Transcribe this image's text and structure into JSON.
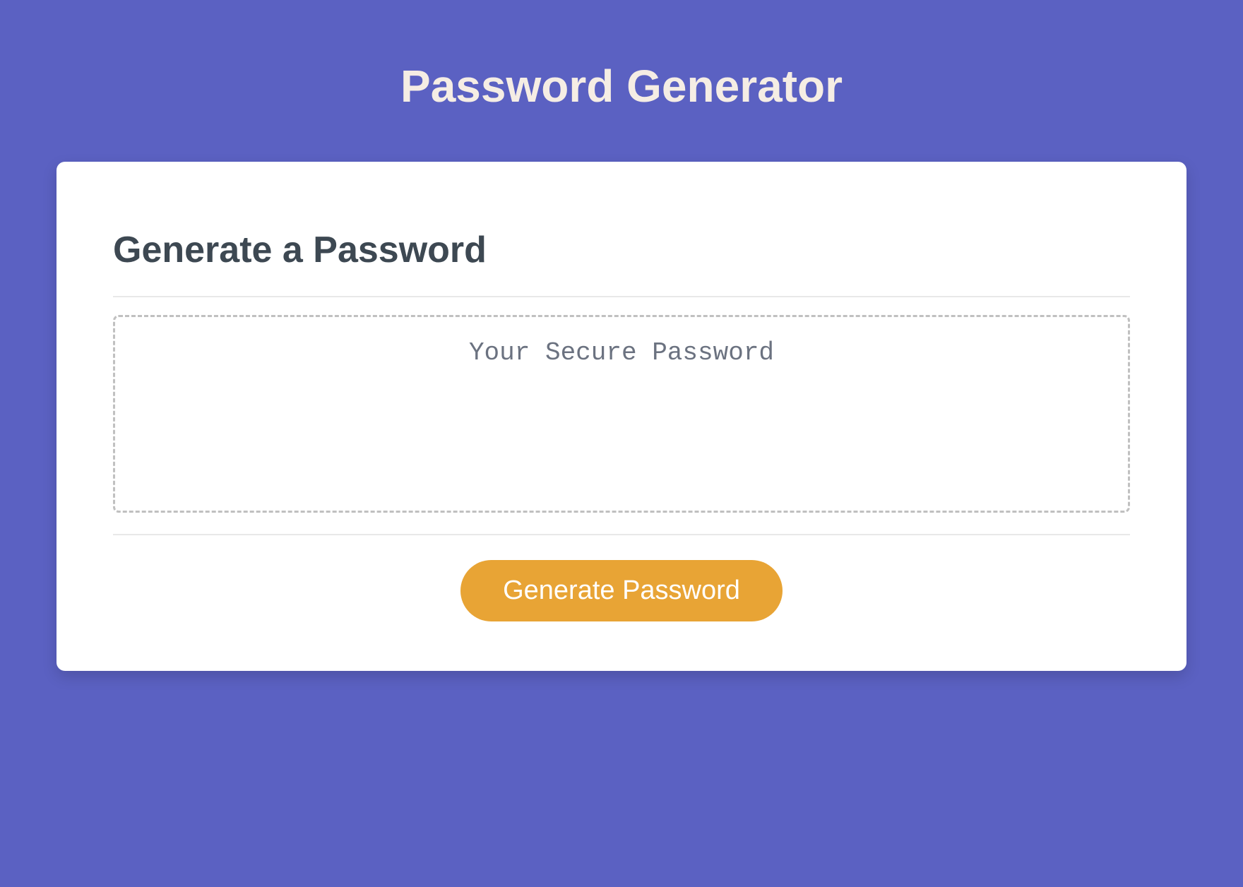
{
  "header": {
    "title": "Password Generator"
  },
  "card": {
    "heading": "Generate a Password",
    "output_placeholder": "Your Secure Password",
    "output_value": "",
    "button_label": "Generate Password"
  },
  "colors": {
    "background": "#5b61c2",
    "card_bg": "#ffffff",
    "title_text": "#f5ede4",
    "heading_text": "#3d4852",
    "button_bg": "#e8a435",
    "button_text": "#ffffff",
    "border_dashed": "#c0c0c0"
  }
}
